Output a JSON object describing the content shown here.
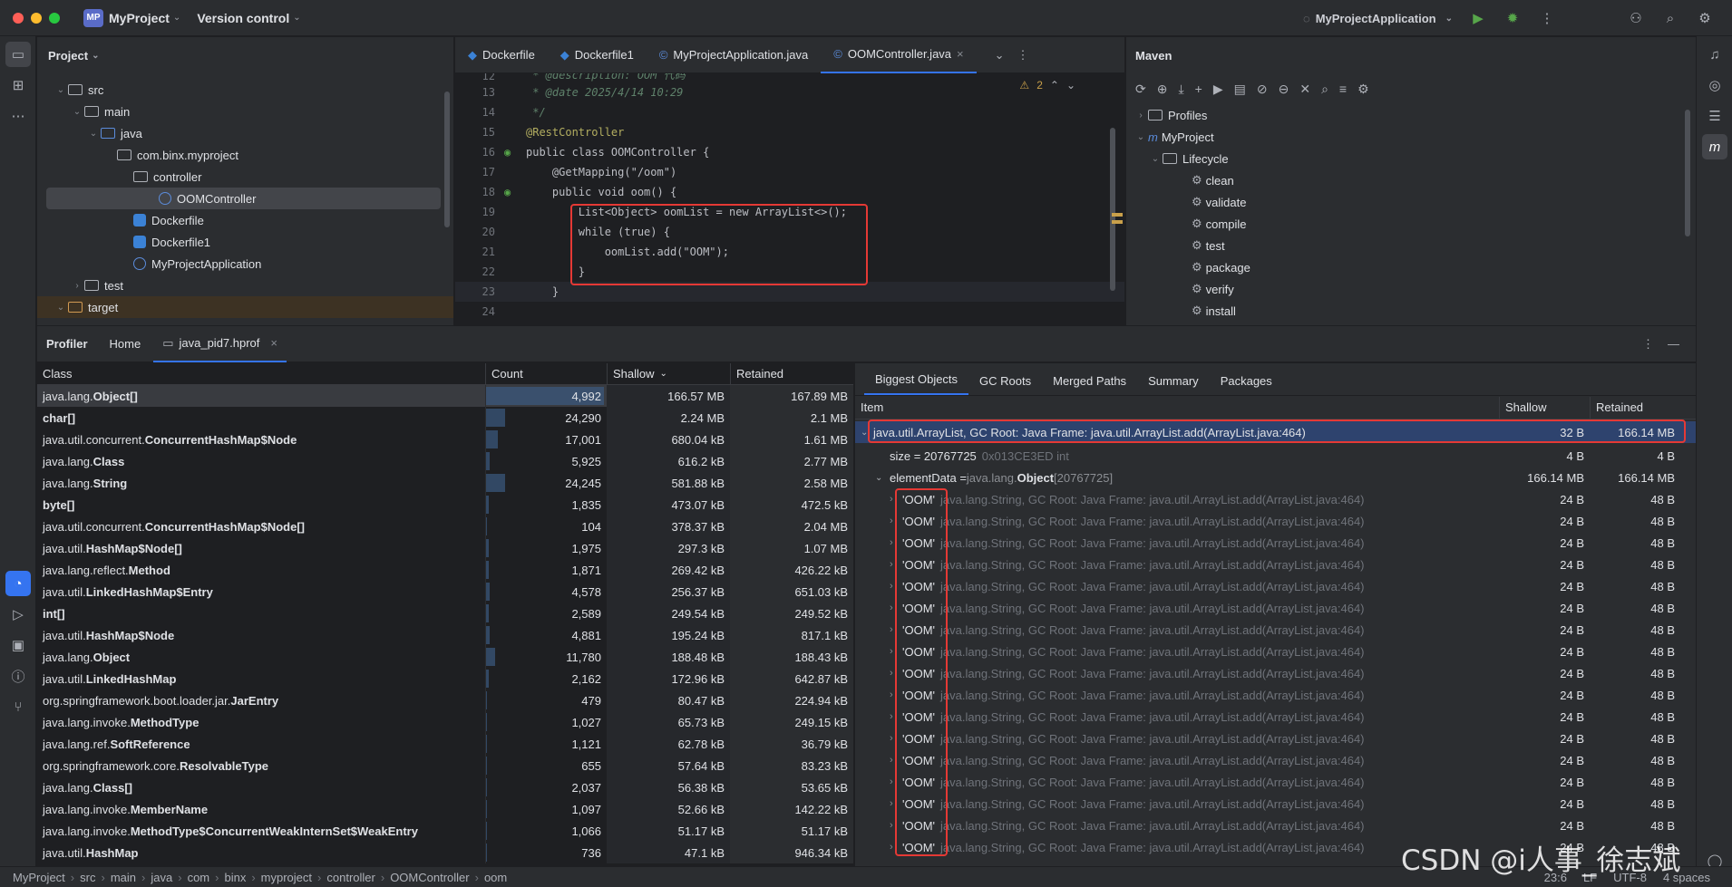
{
  "titlebar": {
    "project_badge": "MP",
    "project": "MyProject",
    "vcs": "Version control",
    "run_config": "MyProjectApplication"
  },
  "project_panel": {
    "title": "Project",
    "tree": [
      {
        "label": "src",
        "depth": 1,
        "kind": "folder",
        "open": true
      },
      {
        "label": "main",
        "depth": 2,
        "kind": "folder",
        "open": true
      },
      {
        "label": "java",
        "depth": 3,
        "kind": "folder-blue",
        "open": true
      },
      {
        "label": "com.binx.myproject",
        "depth": 4,
        "kind": "package",
        "open": true
      },
      {
        "label": "controller",
        "depth": 5,
        "kind": "package",
        "open": true
      },
      {
        "label": "OOMController",
        "depth": 6,
        "kind": "class",
        "selected": true
      },
      {
        "label": "Dockerfile",
        "depth": 5,
        "kind": "docker"
      },
      {
        "label": "Dockerfile1",
        "depth": 5,
        "kind": "docker"
      },
      {
        "label": "MyProjectApplication",
        "depth": 5,
        "kind": "class"
      },
      {
        "label": "test",
        "depth": 2,
        "kind": "folder",
        "open": false
      },
      {
        "label": "target",
        "depth": 1,
        "kind": "folder-orange",
        "open": true
      }
    ]
  },
  "editor": {
    "tabs": [
      "Dockerfile",
      "Dockerfile1",
      "MyProjectApplication.java",
      "OOMController.java"
    ],
    "active_tab": 3,
    "warnings": "2",
    "lines": [
      {
        "n": "12",
        "t": " * @description: OOM 代码"
      },
      {
        "n": "13",
        "t": " * @date 2025/4/14 10:29"
      },
      {
        "n": "14",
        "t": " */"
      },
      {
        "n": "15",
        "t": "@RestController"
      },
      {
        "n": "16",
        "t": "public class OOMController {"
      },
      {
        "n": "17",
        "t": "    @GetMapping(\"/oom\")"
      },
      {
        "n": "18",
        "t": "    public void oom() {"
      },
      {
        "n": "19",
        "t": "        List<Object> oomList = new ArrayList<>();"
      },
      {
        "n": "20",
        "t": "        while (true) {"
      },
      {
        "n": "21",
        "t": "            oomList.add(\"OOM\");"
      },
      {
        "n": "22",
        "t": "        }"
      },
      {
        "n": "23",
        "t": "    }"
      },
      {
        "n": "24",
        "t": ""
      }
    ]
  },
  "maven": {
    "title": "Maven",
    "tree": [
      {
        "label": "Profiles",
        "depth": 0,
        "kind": "folder"
      },
      {
        "label": "MyProject",
        "depth": 0,
        "kind": "maven",
        "open": true
      },
      {
        "label": "Lifecycle",
        "depth": 1,
        "kind": "folder",
        "open": true
      },
      {
        "label": "clean",
        "depth": 2,
        "kind": "gear"
      },
      {
        "label": "validate",
        "depth": 2,
        "kind": "gear"
      },
      {
        "label": "compile",
        "depth": 2,
        "kind": "gear"
      },
      {
        "label": "test",
        "depth": 2,
        "kind": "gear"
      },
      {
        "label": "package",
        "depth": 2,
        "kind": "gear"
      },
      {
        "label": "verify",
        "depth": 2,
        "kind": "gear"
      },
      {
        "label": "install",
        "depth": 2,
        "kind": "gear"
      }
    ]
  },
  "profiler": {
    "tabs": [
      "Profiler",
      "Home",
      "java_pid7.hprof"
    ],
    "columns": [
      "Class",
      "Count",
      "Shallow",
      "Retained"
    ],
    "rows": [
      {
        "cls": "java.lang.",
        "b": "Object[]",
        "count": "4,992",
        "shallow": "166.57 MB",
        "retained": "167.89 MB",
        "bar": 1.0
      },
      {
        "cls": "",
        "b": "char[]",
        "count": "24,290",
        "shallow": "2.24 MB",
        "retained": "2.1 MB",
        "bar": 0.16
      },
      {
        "cls": "java.util.concurrent.",
        "b": "ConcurrentHashMap$Node",
        "count": "17,001",
        "shallow": "680.04 kB",
        "retained": "1.61 MB",
        "bar": 0.1
      },
      {
        "cls": "java.lang.",
        "b": "Class",
        "count": "5,925",
        "shallow": "616.2 kB",
        "retained": "2.77 MB",
        "bar": 0.03
      },
      {
        "cls": "java.lang.",
        "b": "String",
        "count": "24,245",
        "shallow": "581.88 kB",
        "retained": "2.58 MB",
        "bar": 0.16
      },
      {
        "cls": "",
        "b": "byte[]",
        "count": "1,835",
        "shallow": "473.07 kB",
        "retained": "472.5 kB",
        "bar": 0.02
      },
      {
        "cls": "java.util.concurrent.",
        "b": "ConcurrentHashMap$Node[]",
        "count": "104",
        "shallow": "378.37 kB",
        "retained": "2.04 MB",
        "bar": 0.01
      },
      {
        "cls": "java.util.",
        "b": "HashMap$Node[]",
        "count": "1,975",
        "shallow": "297.3 kB",
        "retained": "1.07 MB",
        "bar": 0.02
      },
      {
        "cls": "java.lang.reflect.",
        "b": "Method",
        "count": "1,871",
        "shallow": "269.42 kB",
        "retained": "426.22 kB",
        "bar": 0.02
      },
      {
        "cls": "java.util.",
        "b": "LinkedHashMap$Entry",
        "count": "4,578",
        "shallow": "256.37 kB",
        "retained": "651.03 kB",
        "bar": 0.03
      },
      {
        "cls": "",
        "b": "int[]",
        "count": "2,589",
        "shallow": "249.54 kB",
        "retained": "249.52 kB",
        "bar": 0.02
      },
      {
        "cls": "java.util.",
        "b": "HashMap$Node",
        "count": "4,881",
        "shallow": "195.24 kB",
        "retained": "817.1 kB",
        "bar": 0.03
      },
      {
        "cls": "java.lang.",
        "b": "Object",
        "count": "11,780",
        "shallow": "188.48 kB",
        "retained": "188.43 kB",
        "bar": 0.08
      },
      {
        "cls": "java.util.",
        "b": "LinkedHashMap",
        "count": "2,162",
        "shallow": "172.96 kB",
        "retained": "642.87 kB",
        "bar": 0.02
      },
      {
        "cls": "org.springframework.boot.loader.jar.",
        "b": "JarEntry",
        "count": "479",
        "shallow": "80.47 kB",
        "retained": "224.94 kB",
        "bar": 0.01
      },
      {
        "cls": "java.lang.invoke.",
        "b": "MethodType",
        "count": "1,027",
        "shallow": "65.73 kB",
        "retained": "249.15 kB",
        "bar": 0.01
      },
      {
        "cls": "java.lang.ref.",
        "b": "SoftReference",
        "count": "1,121",
        "shallow": "62.78 kB",
        "retained": "36.79 kB",
        "bar": 0.01
      },
      {
        "cls": "org.springframework.core.",
        "b": "ResolvableType",
        "count": "655",
        "shallow": "57.64 kB",
        "retained": "83.23 kB",
        "bar": 0.01
      },
      {
        "cls": "java.lang.",
        "b": "Class[]",
        "count": "2,037",
        "shallow": "56.38 kB",
        "retained": "53.65 kB",
        "bar": 0.01
      },
      {
        "cls": "java.lang.invoke.",
        "b": "MemberName",
        "count": "1,097",
        "shallow": "52.66 kB",
        "retained": "142.22 kB",
        "bar": 0.01
      },
      {
        "cls": "java.lang.invoke.",
        "b": "MethodType$ConcurrentWeakInternSet$WeakEntry",
        "count": "1,066",
        "shallow": "51.17 kB",
        "retained": "51.17 kB",
        "bar": 0.01
      },
      {
        "cls": "java.util.",
        "b": "HashMap",
        "count": "736",
        "shallow": "47.1 kB",
        "retained": "946.34 kB",
        "bar": 0.01
      }
    ]
  },
  "objects": {
    "tabs": [
      "Biggest Objects",
      "GC Roots",
      "Merged Paths",
      "Summary",
      "Packages"
    ],
    "columns": [
      "Item",
      "Shallow",
      "Retained"
    ],
    "root": {
      "text": "java.util.ArrayList, GC Root: Java Frame: java.util.ArrayList.add(ArrayList.java:464)",
      "shallow": "32 B",
      "retained": "166.14 MB"
    },
    "size": {
      "name": "size = 20767725",
      "extra": "0x013CE3ED  int",
      "shallow": "4 B",
      "retained": "4 B"
    },
    "elem": {
      "name": "elementData = ",
      "type": "java.lang.",
      "typeb": "Object",
      "dims": "[20767725]",
      "shallow": "166.14 MB",
      "retained": "166.14 MB"
    },
    "child": {
      "val": "'OOM'",
      "desc": "java.lang.String, GC Root: Java Frame: java.util.ArrayList.add(ArrayList.java:464)",
      "shallow": "24 B",
      "retained": "48 B"
    },
    "child_count": 17
  },
  "status": {
    "crumbs": [
      "MyProject",
      "src",
      "main",
      "java",
      "com",
      "binx",
      "myproject",
      "controller",
      "OOMController",
      "oom"
    ],
    "pos": "23:6",
    "lf": "LF",
    "enc": "UTF-8",
    "indent": "4 spaces"
  },
  "watermark": "CSDN @i人事_徐志斌"
}
